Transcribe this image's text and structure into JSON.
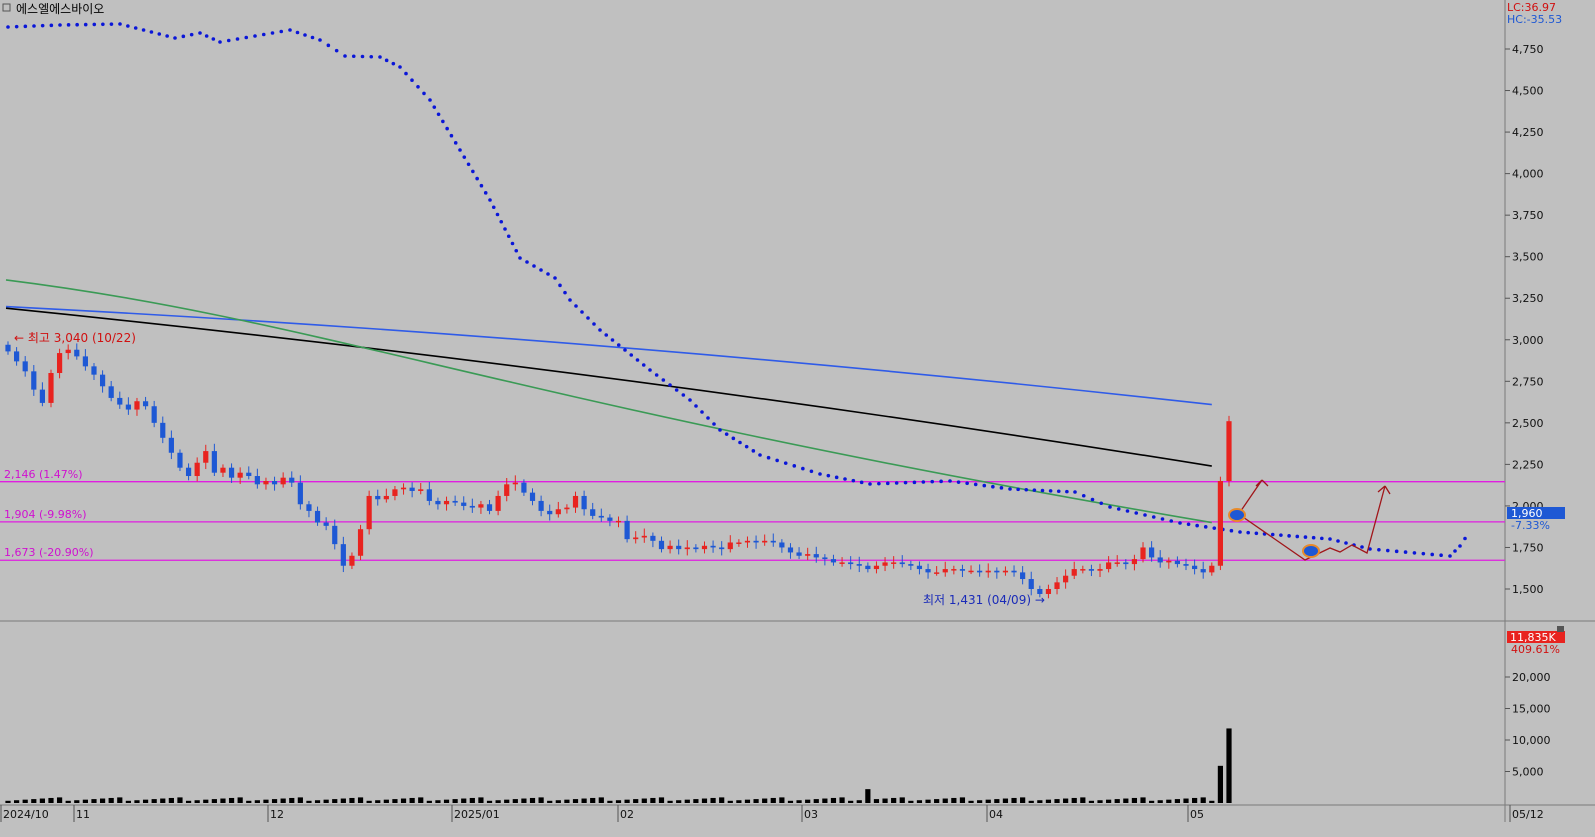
{
  "header": {
    "title": "에스엘에스바이오",
    "lc": "LC:36.97",
    "hc": "HC:-35.53"
  },
  "annotations": {
    "high": "최고 3,040 (10/22)",
    "low": "최저 1,431 (04/09)",
    "lines": [
      {
        "label": "2,146 (1.47%)",
        "value": 2146
      },
      {
        "label": "1,904 (-9.98%)",
        "value": 1904
      },
      {
        "label": "1,673 (-20.90%)",
        "value": 1673
      }
    ]
  },
  "price_axis": {
    "ticks": [
      "4,750",
      "4,500",
      "4,250",
      "4,000",
      "3,750",
      "3,500",
      "3,250",
      "3,000",
      "2,750",
      "2,500",
      "2,250",
      "2,000",
      "1,750",
      "1,500"
    ],
    "current_badge": "1,960",
    "change_pct": "-7.33%"
  },
  "volume_axis": {
    "ticks": [
      "20,000",
      "15,000",
      "10,000",
      "5,000"
    ],
    "current_badge": "11,835K",
    "change_pct": "409.61%"
  },
  "time_axis": {
    "labels": [
      "2024/10",
      "11",
      "12",
      "2025/01",
      "02",
      "03",
      "04",
      "05",
      "05/12"
    ]
  },
  "colors": {
    "up": "#e8231f",
    "down": "#1e58d4",
    "bg": "#c0c0c0",
    "dots": "#0a16d8",
    "ma_blue": "#2f5be8",
    "ma_black": "#000000",
    "ma_green": "#3a9a55",
    "hline": "#e01ee0",
    "volume": "#000000",
    "arrow": "#a0161a"
  },
  "chart_data": {
    "type": "candlestick",
    "y_range": [
      1420,
      4900
    ],
    "candles_close": [
      2930,
      2870,
      2810,
      2700,
      2620,
      2800,
      2920,
      2940,
      2900,
      2840,
      2790,
      2720,
      2650,
      2610,
      2580,
      2630,
      2600,
      2500,
      2410,
      2320,
      2230,
      2180,
      2260,
      2330,
      2200,
      2230,
      2170,
      2200,
      2180,
      2130,
      2150,
      2130,
      2170,
      2140,
      2010,
      1970,
      1900,
      1880,
      1770,
      1640,
      1700,
      1860,
      2060,
      2040,
      2060,
      2100,
      2110,
      2090,
      2100,
      2030,
      2010,
      2030,
      2020,
      2000,
      1990,
      2010,
      1970,
      2060,
      2130,
      2140,
      2080,
      2030,
      1970,
      1950,
      1980,
      1990,
      2060,
      1980,
      1940,
      1930,
      1910,
      1910,
      1800,
      1810,
      1820,
      1790,
      1740,
      1760,
      1740,
      1750,
      1740,
      1760,
      1750,
      1740,
      1780,
      1780,
      1790,
      1780,
      1790,
      1780,
      1750,
      1720,
      1700,
      1710,
      1690,
      1680,
      1660,
      1660,
      1650,
      1640,
      1620,
      1640,
      1660,
      1660,
      1650,
      1640,
      1620,
      1600,
      1600,
      1620,
      1620,
      1610,
      1610,
      1600,
      1610,
      1600,
      1610,
      1600,
      1560,
      1500,
      1470,
      1500,
      1540,
      1580,
      1620,
      1620,
      1610,
      1620,
      1660,
      1660,
      1650,
      1680,
      1750,
      1690,
      1660,
      1670,
      1650,
      1640,
      1620,
      1600,
      1640,
      2150,
      2510
    ],
    "moving_averages": [
      {
        "x": [
          0,
          140
        ],
        "y": [
          3200,
          2610
        ],
        "color": "blue"
      },
      {
        "x": [
          0,
          140
        ],
        "y": [
          3190,
          2240
        ],
        "color": "black"
      },
      {
        "x": [
          0,
          140
        ],
        "y": [
          3360,
          1900
        ],
        "color": "green"
      }
    ],
    "volume_range": [
      0,
      25000
    ],
    "volume_last": [
      5900,
      11835
    ]
  }
}
